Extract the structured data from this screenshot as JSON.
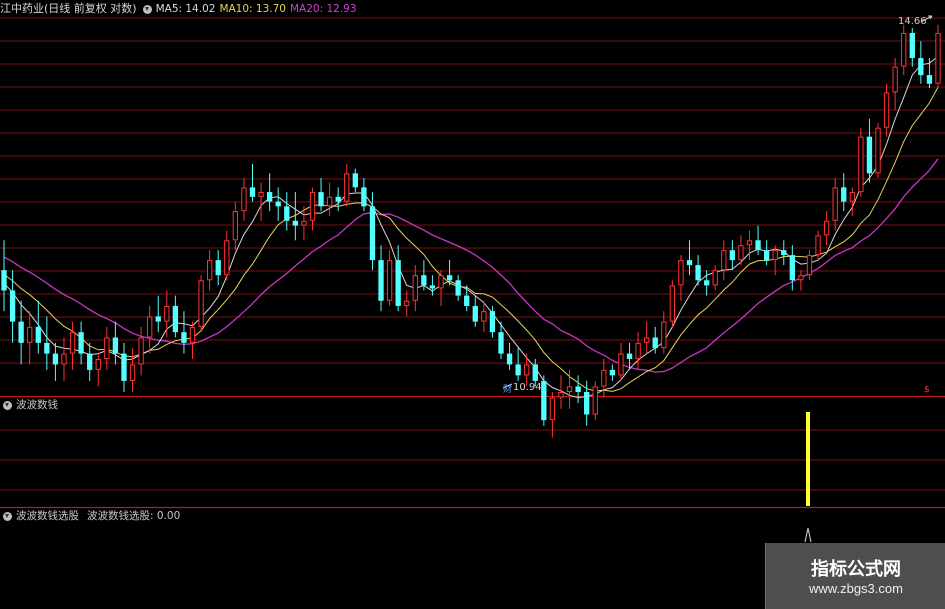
{
  "main_panel": {
    "title": "江中药业(日线 前复权 对数)",
    "ma5_label": "MA5: 14.02",
    "ma10_label": "MA10: 13.70",
    "ma20_label": "MA20: 12.93",
    "high_label": "14.66",
    "low_label": "10.94",
    "low_marker": "财",
    "right_marker": "$"
  },
  "panel2": {
    "title": "波波数钱"
  },
  "panel3": {
    "title": "波波数钱选股",
    "value_label": "波波数钱选股: 0.00"
  },
  "colors": {
    "up": "#ff3232",
    "down": "#54ffff",
    "ma5": "#d8d8d8",
    "ma10": "#e6d35a",
    "ma20": "#c637c6",
    "grid": "#7a1010",
    "divider": "#c81414",
    "signal": "#ffff32"
  },
  "watermark": {
    "title": "指标公式网",
    "url": "www.zbgs3.com"
  },
  "chart_data": {
    "type": "candlestick",
    "series": [
      {
        "name": "MA5",
        "value": 14.02
      },
      {
        "name": "MA10",
        "value": 13.7
      },
      {
        "name": "MA20",
        "value": 12.93
      }
    ],
    "annotations": [
      {
        "text": "14.66",
        "kind": "high"
      },
      {
        "text": "10.94",
        "kind": "low"
      }
    ],
    "candles": [
      [
        12.0,
        12.3,
        11.6,
        11.8
      ],
      [
        11.8,
        12.0,
        11.3,
        11.5
      ],
      [
        11.5,
        11.7,
        11.1,
        11.3
      ],
      [
        11.3,
        11.6,
        11.1,
        11.45
      ],
      [
        11.45,
        11.7,
        11.2,
        11.3
      ],
      [
        11.3,
        11.55,
        11.05,
        11.2
      ],
      [
        11.2,
        11.3,
        10.95,
        11.1
      ],
      [
        11.1,
        11.35,
        10.95,
        11.2
      ],
      [
        11.2,
        11.5,
        11.05,
        11.4
      ],
      [
        11.4,
        11.5,
        11.1,
        11.2
      ],
      [
        11.2,
        11.3,
        10.95,
        11.05
      ],
      [
        11.05,
        11.2,
        10.9,
        11.15
      ],
      [
        11.15,
        11.45,
        11.05,
        11.35
      ],
      [
        11.35,
        11.5,
        11.1,
        11.2
      ],
      [
        11.2,
        11.3,
        10.85,
        10.95
      ],
      [
        10.95,
        11.25,
        10.85,
        11.1
      ],
      [
        11.1,
        11.45,
        11.0,
        11.35
      ],
      [
        11.35,
        11.65,
        11.2,
        11.55
      ],
      [
        11.55,
        11.75,
        11.4,
        11.5
      ],
      [
        11.5,
        11.8,
        11.35,
        11.65
      ],
      [
        11.65,
        11.75,
        11.35,
        11.4
      ],
      [
        11.4,
        11.6,
        11.2,
        11.3
      ],
      [
        11.3,
        11.5,
        11.15,
        11.45
      ],
      [
        11.45,
        11.95,
        11.4,
        11.9
      ],
      [
        11.9,
        12.2,
        11.8,
        12.1
      ],
      [
        12.1,
        12.2,
        11.85,
        11.95
      ],
      [
        11.95,
        12.4,
        11.9,
        12.3
      ],
      [
        12.3,
        12.7,
        12.2,
        12.6
      ],
      [
        12.6,
        12.95,
        12.5,
        12.85
      ],
      [
        12.85,
        13.1,
        12.7,
        12.75
      ],
      [
        12.75,
        12.9,
        12.5,
        12.8
      ],
      [
        12.8,
        13.0,
        12.6,
        12.7
      ],
      [
        12.7,
        12.85,
        12.5,
        12.65
      ],
      [
        12.65,
        12.8,
        12.4,
        12.5
      ],
      [
        12.5,
        12.8,
        12.3,
        12.45
      ],
      [
        12.45,
        12.65,
        12.3,
        12.5
      ],
      [
        12.5,
        12.85,
        12.4,
        12.8
      ],
      [
        12.8,
        12.95,
        12.6,
        12.65
      ],
      [
        12.65,
        12.9,
        12.55,
        12.75
      ],
      [
        12.75,
        12.85,
        12.6,
        12.7
      ],
      [
        12.7,
        13.1,
        12.65,
        13.0
      ],
      [
        13.0,
        13.05,
        12.8,
        12.85
      ],
      [
        12.85,
        12.95,
        12.6,
        12.65
      ],
      [
        12.65,
        12.8,
        12.0,
        12.1
      ],
      [
        12.1,
        12.25,
        11.6,
        11.7
      ],
      [
        11.7,
        12.2,
        11.65,
        12.1
      ],
      [
        12.1,
        12.25,
        11.6,
        11.65
      ],
      [
        11.65,
        11.8,
        11.55,
        11.7
      ],
      [
        11.7,
        12.05,
        11.6,
        11.95
      ],
      [
        11.95,
        12.1,
        11.8,
        11.85
      ],
      [
        11.85,
        11.95,
        11.75,
        11.82
      ],
      [
        11.82,
        12.0,
        11.65,
        11.95
      ],
      [
        11.95,
        12.1,
        11.85,
        11.9
      ],
      [
        11.9,
        11.95,
        11.7,
        11.75
      ],
      [
        11.75,
        11.85,
        11.6,
        11.65
      ],
      [
        11.65,
        11.75,
        11.45,
        11.5
      ],
      [
        11.5,
        11.7,
        11.4,
        11.6
      ],
      [
        11.6,
        11.65,
        11.35,
        11.4
      ],
      [
        11.4,
        11.5,
        11.15,
        11.2
      ],
      [
        11.2,
        11.3,
        11.05,
        11.1
      ],
      [
        11.1,
        11.25,
        10.95,
        11.0
      ],
      [
        11.0,
        11.2,
        10.9,
        11.1
      ],
      [
        11.1,
        11.15,
        10.9,
        10.95
      ],
      [
        10.95,
        11.0,
        10.55,
        10.6
      ],
      [
        10.6,
        10.85,
        10.45,
        10.8
      ],
      [
        10.8,
        11.0,
        10.7,
        10.85
      ],
      [
        10.85,
        11.05,
        10.7,
        10.9
      ],
      [
        10.9,
        11.0,
        10.75,
        10.85
      ],
      [
        10.85,
        10.95,
        10.55,
        10.65
      ],
      [
        10.65,
        10.95,
        10.6,
        10.9
      ],
      [
        10.9,
        11.15,
        10.8,
        11.05
      ],
      [
        11.05,
        11.1,
        10.95,
        11.0
      ],
      [
        11.0,
        11.3,
        10.95,
        11.2
      ],
      [
        11.2,
        11.3,
        11.05,
        11.15
      ],
      [
        11.15,
        11.4,
        11.05,
        11.3
      ],
      [
        11.3,
        11.5,
        11.2,
        11.35
      ],
      [
        11.35,
        11.45,
        11.2,
        11.25
      ],
      [
        11.25,
        11.6,
        11.2,
        11.5
      ],
      [
        11.5,
        11.9,
        11.45,
        11.85
      ],
      [
        11.85,
        12.15,
        11.7,
        12.1
      ],
      [
        12.1,
        12.3,
        11.95,
        12.05
      ],
      [
        12.05,
        12.15,
        11.85,
        11.9
      ],
      [
        11.9,
        12.0,
        11.75,
        11.85
      ],
      [
        11.85,
        12.05,
        11.8,
        12.0
      ],
      [
        12.0,
        12.3,
        11.9,
        12.2
      ],
      [
        12.2,
        12.3,
        12.0,
        12.1
      ],
      [
        12.1,
        12.35,
        12.05,
        12.25
      ],
      [
        12.25,
        12.4,
        12.1,
        12.3
      ],
      [
        12.3,
        12.45,
        12.15,
        12.2
      ],
      [
        12.2,
        12.3,
        12.05,
        12.1
      ],
      [
        12.1,
        12.25,
        11.95,
        12.2
      ],
      [
        12.2,
        12.3,
        12.05,
        12.15
      ],
      [
        12.15,
        12.25,
        11.8,
        11.9
      ],
      [
        11.9,
        12.0,
        11.8,
        11.95
      ],
      [
        11.95,
        12.2,
        11.9,
        12.15
      ],
      [
        12.15,
        12.4,
        12.1,
        12.35
      ],
      [
        12.35,
        12.6,
        12.25,
        12.5
      ],
      [
        12.5,
        12.95,
        12.4,
        12.85
      ],
      [
        12.85,
        13.0,
        12.6,
        12.7
      ],
      [
        12.7,
        12.85,
        12.55,
        12.8
      ],
      [
        12.8,
        13.5,
        12.75,
        13.4
      ],
      [
        13.4,
        13.6,
        12.9,
        13.0
      ],
      [
        13.0,
        13.55,
        12.95,
        13.5
      ],
      [
        13.5,
        14.0,
        13.4,
        13.9
      ],
      [
        13.9,
        14.3,
        13.7,
        14.2
      ],
      [
        14.2,
        14.7,
        14.1,
        14.6
      ],
      [
        14.6,
        14.66,
        14.2,
        14.3
      ],
      [
        14.3,
        14.5,
        14.0,
        14.1
      ],
      [
        14.1,
        14.3,
        13.95,
        14.0
      ],
      [
        14.0,
        14.7,
        13.95,
        14.6
      ]
    ]
  }
}
